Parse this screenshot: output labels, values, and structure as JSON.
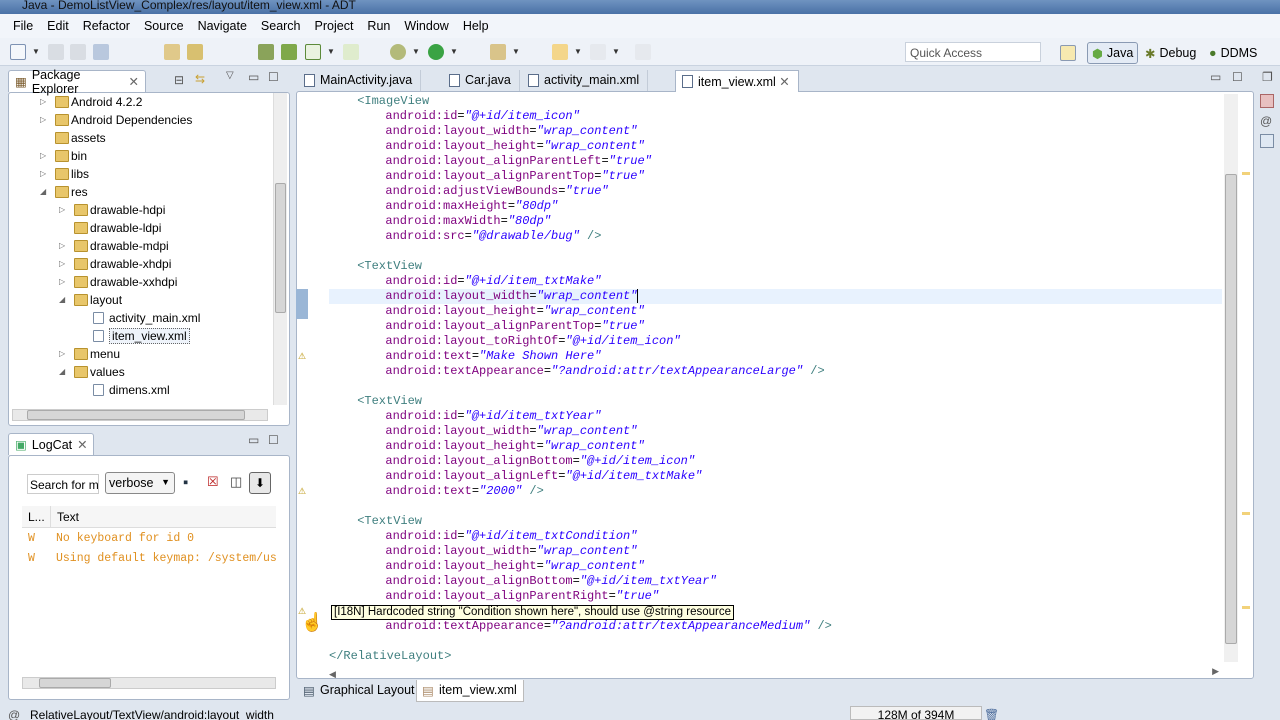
{
  "window": {
    "title": "Java - DemoListView_Complex/res/layout/item_view.xml - ADT"
  },
  "menu": [
    "File",
    "Edit",
    "Refactor",
    "Source",
    "Navigate",
    "Search",
    "Project",
    "Run",
    "Window",
    "Help"
  ],
  "toolbar": {
    "quick_access_placeholder": "Quick Access",
    "perspectives": [
      "Java",
      "Debug",
      "DDMS"
    ]
  },
  "package_explorer": {
    "title": "Package Explorer",
    "items": [
      {
        "label": "Android 4.2.2",
        "level": 0,
        "arrow": "collapsed",
        "type": "lib"
      },
      {
        "label": "Android Dependencies",
        "level": 0,
        "arrow": "collapsed",
        "type": "lib"
      },
      {
        "label": "assets",
        "level": 0,
        "arrow": "none",
        "type": "folder"
      },
      {
        "label": "bin",
        "level": 0,
        "arrow": "collapsed",
        "type": "folder"
      },
      {
        "label": "libs",
        "level": 0,
        "arrow": "collapsed",
        "type": "folder"
      },
      {
        "label": "res",
        "level": 0,
        "arrow": "expanded",
        "type": "folder"
      },
      {
        "label": "drawable-hdpi",
        "level": 1,
        "arrow": "collapsed",
        "type": "folder"
      },
      {
        "label": "drawable-ldpi",
        "level": 1,
        "arrow": "none",
        "type": "folder"
      },
      {
        "label": "drawable-mdpi",
        "level": 1,
        "arrow": "collapsed",
        "type": "folder"
      },
      {
        "label": "drawable-xhdpi",
        "level": 1,
        "arrow": "collapsed",
        "type": "folder"
      },
      {
        "label": "drawable-xxhdpi",
        "level": 1,
        "arrow": "collapsed",
        "type": "folder"
      },
      {
        "label": "layout",
        "level": 1,
        "arrow": "expanded",
        "type": "folder"
      },
      {
        "label": "activity_main.xml",
        "level": 2,
        "arrow": "none",
        "type": "file"
      },
      {
        "label": "item_view.xml",
        "level": 2,
        "arrow": "none",
        "type": "file",
        "selected": true
      },
      {
        "label": "menu",
        "level": 1,
        "arrow": "collapsed",
        "type": "folder"
      },
      {
        "label": "values",
        "level": 1,
        "arrow": "expanded",
        "type": "folder"
      },
      {
        "label": "dimens.xml",
        "level": 2,
        "arrow": "none",
        "type": "file"
      }
    ]
  },
  "logcat": {
    "title": "LogCat",
    "search_placeholder": "Search for m",
    "level": "verbose",
    "columns": [
      "L...",
      "Text"
    ],
    "rows": [
      {
        "level": "W",
        "text": "No keyboard for id 0"
      },
      {
        "level": "W",
        "text": "Using default keymap: /system/us"
      }
    ]
  },
  "editor": {
    "tabs": [
      {
        "label": "MainActivity.java"
      },
      {
        "label": "Car.java"
      },
      {
        "label": "activity_main.xml"
      },
      {
        "label": "item_view.xml",
        "active": true
      }
    ],
    "bottom_tabs": [
      "Graphical Layout",
      "item_view.xml"
    ],
    "tooltip": "[I18N] Hardcoded string \"Condition shown here\", should use @string resource",
    "lines": [
      {
        "i": 1,
        "t": "<ImageView"
      },
      {
        "i": 2,
        "a": "android:id",
        "v": "\"@+id/item_icon\""
      },
      {
        "i": 2,
        "a": "android:layout_width",
        "v": "\"wrap_content\""
      },
      {
        "i": 2,
        "a": "android:layout_height",
        "v": "\"wrap_content\""
      },
      {
        "i": 2,
        "a": "android:layout_alignParentLeft",
        "v": "\"true\""
      },
      {
        "i": 2,
        "a": "android:layout_alignParentTop",
        "v": "\"true\""
      },
      {
        "i": 2,
        "a": "android:adjustViewBounds",
        "v": "\"true\""
      },
      {
        "i": 2,
        "a": "android:maxHeight",
        "v": "\"80dp\""
      },
      {
        "i": 2,
        "a": "android:maxWidth",
        "v": "\"80dp\""
      },
      {
        "i": 2,
        "a": "android:src",
        "v": "\"@drawable/bug\"",
        "e": " />"
      },
      {},
      {
        "i": 1,
        "t": "<TextView"
      },
      {
        "i": 2,
        "a": "android:id",
        "v": "\"@+id/item_txtMake\""
      },
      {
        "i": 2,
        "a": "android:layout_width",
        "v": "\"wrap_content\"",
        "cursor": true
      },
      {
        "i": 2,
        "a": "android:layout_height",
        "v": "\"wrap_content\""
      },
      {
        "i": 2,
        "a": "android:layout_alignParentTop",
        "v": "\"true\""
      },
      {
        "i": 2,
        "a": "android:layout_toRightOf",
        "v": "\"@+id/item_icon\""
      },
      {
        "i": 2,
        "a": "android:text",
        "v": "\"Make Shown Here\"",
        "warn": true
      },
      {
        "i": 2,
        "a": "android:textAppearance",
        "v": "\"?android:attr/textAppearanceLarge\"",
        "e": " />"
      },
      {},
      {
        "i": 1,
        "t": "<TextView"
      },
      {
        "i": 2,
        "a": "android:id",
        "v": "\"@+id/item_txtYear\""
      },
      {
        "i": 2,
        "a": "android:layout_width",
        "v": "\"wrap_content\""
      },
      {
        "i": 2,
        "a": "android:layout_height",
        "v": "\"wrap_content\""
      },
      {
        "i": 2,
        "a": "android:layout_alignBottom",
        "v": "\"@+id/item_icon\""
      },
      {
        "i": 2,
        "a": "android:layout_alignLeft",
        "v": "\"@+id/item_txtMake\""
      },
      {
        "i": 2,
        "a": "android:text",
        "v": "\"2000\"",
        "e": " />",
        "warn": true
      },
      {},
      {
        "i": 1,
        "t": "<TextView"
      },
      {
        "i": 2,
        "a": "android:id",
        "v": "\"@+id/item_txtCondition\""
      },
      {
        "i": 2,
        "a": "android:layout_width",
        "v": "\"wrap_content\""
      },
      {
        "i": 2,
        "a": "android:layout_height",
        "v": "\"wrap_content\""
      },
      {
        "i": 2,
        "a": "android:layout_alignBottom",
        "v": "\"@+id/item_txtYear\""
      },
      {
        "i": 2,
        "a": "android:layout_alignParentRight",
        "v": "\"true\""
      },
      {
        "warn": true
      },
      {
        "i": 2,
        "a": "android:textAppearance",
        "v": "\"?android:attr/textAppearanceMedium\"",
        "e": " />"
      },
      {},
      {
        "i": 0,
        "t": "</RelativeLayout>"
      }
    ]
  },
  "status": {
    "path": "RelativeLayout/TextView/android:layout_width",
    "memory": "128M of 394M"
  },
  "colors": {
    "tag": "#3f7f7f",
    "attribute": "#7f007f",
    "value": "#2a00ff",
    "warning": "#e09020"
  }
}
